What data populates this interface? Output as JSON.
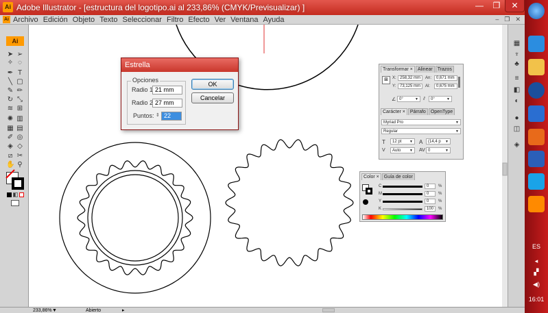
{
  "window": {
    "title": "Adobe Illustrator - [estructura del logotipo.ai al 233,86% (CMYK/Previsualizar) ]",
    "app_icon": "Ai",
    "minimize_icon": "minimize-icon",
    "maximize_icon": "maximize-icon",
    "close_icon": "close-icon"
  },
  "menubar": {
    "icon": "Ai",
    "items": [
      "Archivo",
      "Edición",
      "Objeto",
      "Texto",
      "Seleccionar",
      "Filtro",
      "Efecto",
      "Ver",
      "Ventana",
      "Ayuda"
    ]
  },
  "tools": {
    "badge": "Ai"
  },
  "dialog": {
    "title": "Estrella",
    "group_label": "Opciones",
    "radio1_label": "Radio 1:",
    "radio1_value": "21 mm",
    "radio2_label": "Radio 2:",
    "radio2_value": "27 mm",
    "points_label": "Puntos:",
    "points_value": "22",
    "ok_label": "OK",
    "cancel_label": "Cancelar"
  },
  "transform_panel": {
    "tabs": [
      "Transformar ×",
      "Alinear",
      "Trazos"
    ],
    "x_label": "X:",
    "x_value": "258,32 mm",
    "y_label": "Y:",
    "y_value": "73,125 mm",
    "w_label": "An:",
    "w_value": "0,671 mm",
    "h_label": "Al:",
    "h_value": "0,675 mm",
    "angle_value": "0°",
    "shear_value": "0°"
  },
  "character_panel": {
    "tabs": [
      "Carácter ×",
      "Párrafo",
      "OpenType"
    ],
    "font_family": "Myriad Pro",
    "font_style": "Regular",
    "size_value": "12 pt",
    "leading_value": "(14,4 p",
    "kerning_value": "Auto",
    "tracking_value": "0"
  },
  "color_panel": {
    "tabs": [
      "Color ×",
      "Guía de color"
    ],
    "channels": [
      {
        "label": "C",
        "value": "0",
        "unit": "%"
      },
      {
        "label": "M",
        "value": "0",
        "unit": "%"
      },
      {
        "label": "Y",
        "value": "0",
        "unit": "%"
      },
      {
        "label": "K",
        "value": "100",
        "unit": "%"
      }
    ]
  },
  "statusbar": {
    "zoom": "233,86%",
    "status": "Abierto"
  },
  "taskbar": {
    "lang": "ES",
    "time": "16:01"
  }
}
